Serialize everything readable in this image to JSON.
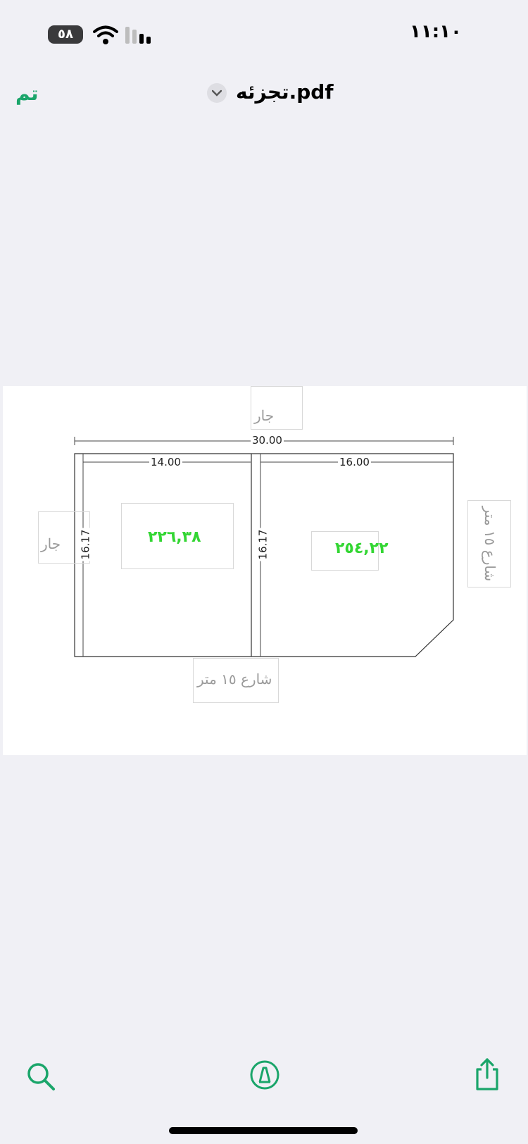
{
  "status_bar": {
    "time": "١١:١٠",
    "battery": "٥٨"
  },
  "nav": {
    "done_label": "تم",
    "title": "تجزئه.pdf"
  },
  "drawing": {
    "top_neighbor": "جار",
    "left_neighbor": "جار",
    "right_street": "شارع ١٥ متر",
    "bottom_street": "شارع ١٥ متر",
    "total_width": "30.00",
    "left_width": "14.00",
    "right_width": "16.00",
    "left_depth": "16.17",
    "right_depth": "16.17",
    "left_area": "٢٢٦,٣٨",
    "right_area": "٢٥٤,٢٢"
  },
  "toolbar": {
    "search": "search-icon",
    "markup": "markup-pen-icon",
    "share": "share-icon"
  },
  "colors": {
    "accent": "#1aa56a",
    "area_text": "#33d633"
  }
}
